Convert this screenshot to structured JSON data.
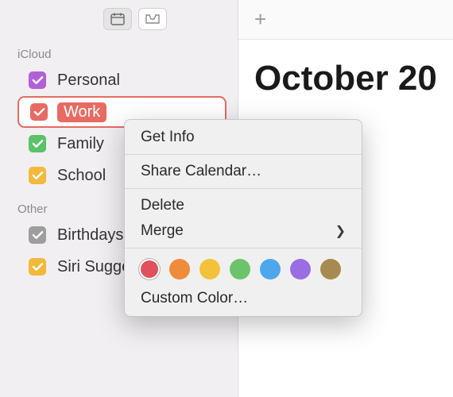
{
  "toolbar": {
    "calendar_icon": "calendar",
    "inbox_icon": "inbox"
  },
  "sidebar": {
    "sections": [
      {
        "title": "iCloud",
        "items": [
          {
            "label": "Personal",
            "color": "#b161d6",
            "checked": true
          },
          {
            "label": "Work",
            "color": "#e66b62",
            "checked": true,
            "selected": true
          },
          {
            "label": "Family",
            "color": "#5bc26a",
            "checked": true
          },
          {
            "label": "School",
            "color": "#f2b93c",
            "checked": true
          }
        ]
      },
      {
        "title": "Other",
        "items": [
          {
            "label": "Birthdays",
            "color": "#9e9e9e",
            "checked": true
          },
          {
            "label": "Siri Suggestions",
            "color": "#f2b93c",
            "checked": true
          }
        ]
      }
    ]
  },
  "main": {
    "add_button": "+",
    "month_label": "October 20"
  },
  "context_menu": {
    "get_info": "Get Info",
    "share": "Share Calendar…",
    "delete": "Delete",
    "merge": "Merge",
    "custom_color": "Custom Color…",
    "colors": [
      {
        "name": "red",
        "hex": "#e0515c",
        "selected": true
      },
      {
        "name": "orange",
        "hex": "#f08b3c"
      },
      {
        "name": "yellow",
        "hex": "#f2c23d"
      },
      {
        "name": "green",
        "hex": "#6bc46a"
      },
      {
        "name": "blue",
        "hex": "#4ea6ef"
      },
      {
        "name": "purple",
        "hex": "#9a6ee2"
      },
      {
        "name": "brown",
        "hex": "#a78a4f"
      }
    ]
  }
}
